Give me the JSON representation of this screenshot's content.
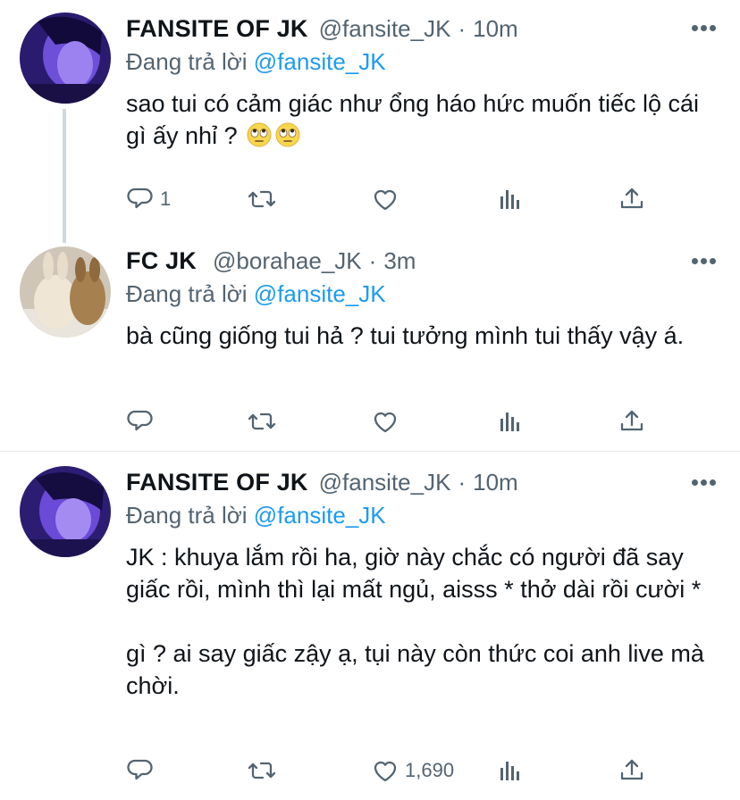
{
  "tweets": [
    {
      "name": "FANSITE OF JK",
      "handle": "@fansite_JK",
      "dot": "·",
      "time": "10m",
      "replying_prefix": "Đang trả lời",
      "replying_to": "@fansite_JK",
      "text": "sao tui có cảm giác như ổng háo hức muốn tiếc lộ cái gì ấy nhỉ ?",
      "emojis": [
        "face-with-rolling-eyes",
        "face-with-rolling-eyes"
      ],
      "reply_count": "1",
      "like_count": ""
    },
    {
      "name": "FC JK",
      "handle": "@borahae_JK",
      "dot": "·",
      "time": "3m",
      "replying_prefix": "Đang trả lời",
      "replying_to": "@fansite_JK",
      "text": "bà cũng giống tui hả ? tui tưởng mình tui thấy vậy á.",
      "reply_count": "",
      "like_count": ""
    },
    {
      "name": "FANSITE OF JK",
      "handle": "@fansite_JK",
      "dot": "·",
      "time": "10m",
      "replying_prefix": "Đang trả lời",
      "replying_to": "@fansite_JK",
      "text": "JK : khuya lắm rồi ha, giờ này chắc có người đã say giấc rồi, mình thì lại mất ngủ, aisss * thở dài rồi cười *\n\ngì ? ai say giấc zậy ạ, tụi này còn thức coi anh live mà chời.",
      "reply_count": "",
      "like_count": "1,690"
    }
  ],
  "colors": {
    "text": "#0f1419",
    "secondary": "#536471",
    "link": "#1d9bf0",
    "divider": "#e1e8ed"
  },
  "icons": [
    "reply-icon",
    "retweet-icon",
    "like-icon",
    "analytics-icon",
    "share-icon",
    "more-icon"
  ]
}
